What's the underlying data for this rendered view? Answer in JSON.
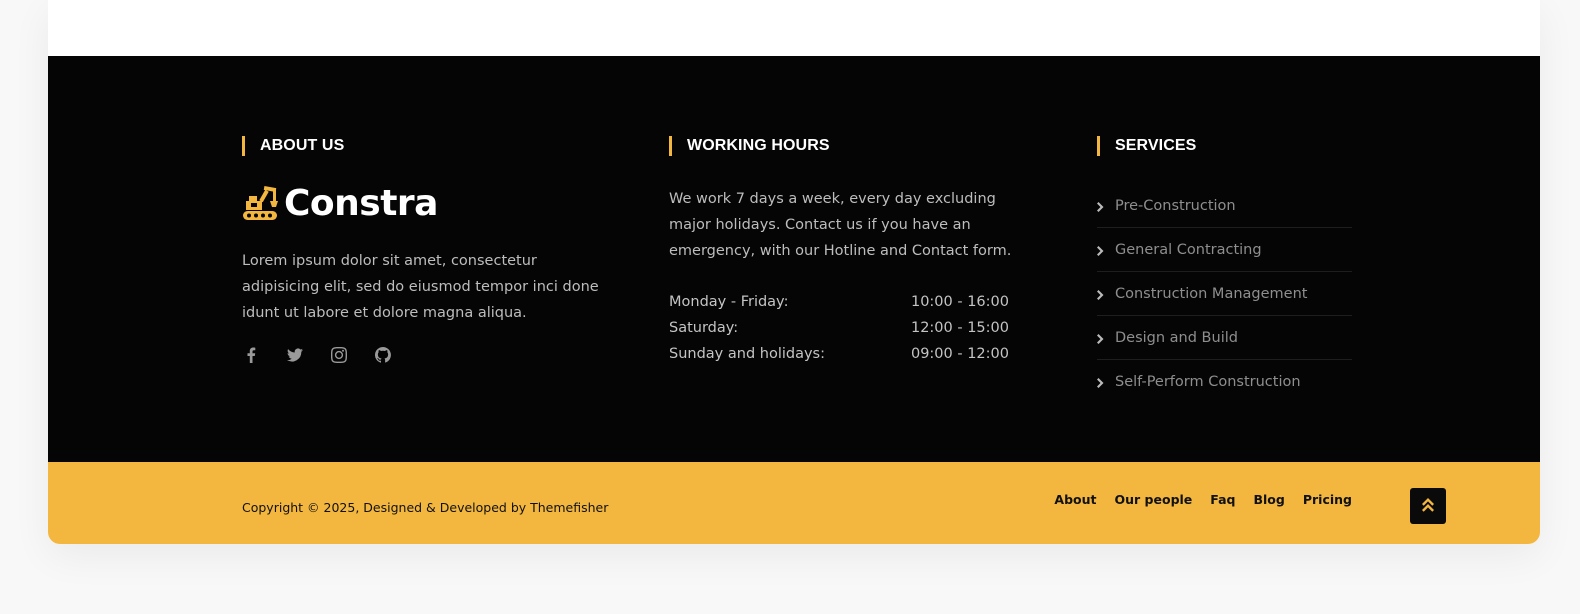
{
  "about": {
    "title": "ABOUT US",
    "logo_text": "Constra",
    "logo_icon": "excavator-icon",
    "description": "Lorem ipsum dolor sit amet, consectetur adipisicing elit, sed do eiusmod tempor inci done idunt ut labore et dolore magna aliqua.",
    "social": [
      "facebook-icon",
      "twitter-icon",
      "instagram-icon",
      "github-icon"
    ]
  },
  "hours": {
    "title": "WORKING HOURS",
    "description": "We work 7 days a week, every day excluding major holidays. Contact us if you have an emergency, with our Hotline and Contact form.",
    "rows": [
      {
        "day": "Monday - Friday:",
        "time": "10:00 - 16:00"
      },
      {
        "day": "Saturday:",
        "time": "12:00 - 15:00"
      },
      {
        "day": "Sunday and holidays:",
        "time": "09:00 - 12:00"
      }
    ]
  },
  "services": {
    "title": "SERVICES",
    "items": [
      "Pre-Construction",
      "General Contracting",
      "Construction Management",
      "Design and Build",
      "Self-Perform Construction"
    ]
  },
  "copyright": {
    "text": "Copyright © 2025, Designed & Developed by Themefisher",
    "nav": [
      "About",
      "Our people",
      "Faq",
      "Blog",
      "Pricing"
    ],
    "back_to_top_icon": "double-chevron-up-icon"
  },
  "colors": {
    "accent": "#f3b63f",
    "footer_bg": "#050505"
  }
}
